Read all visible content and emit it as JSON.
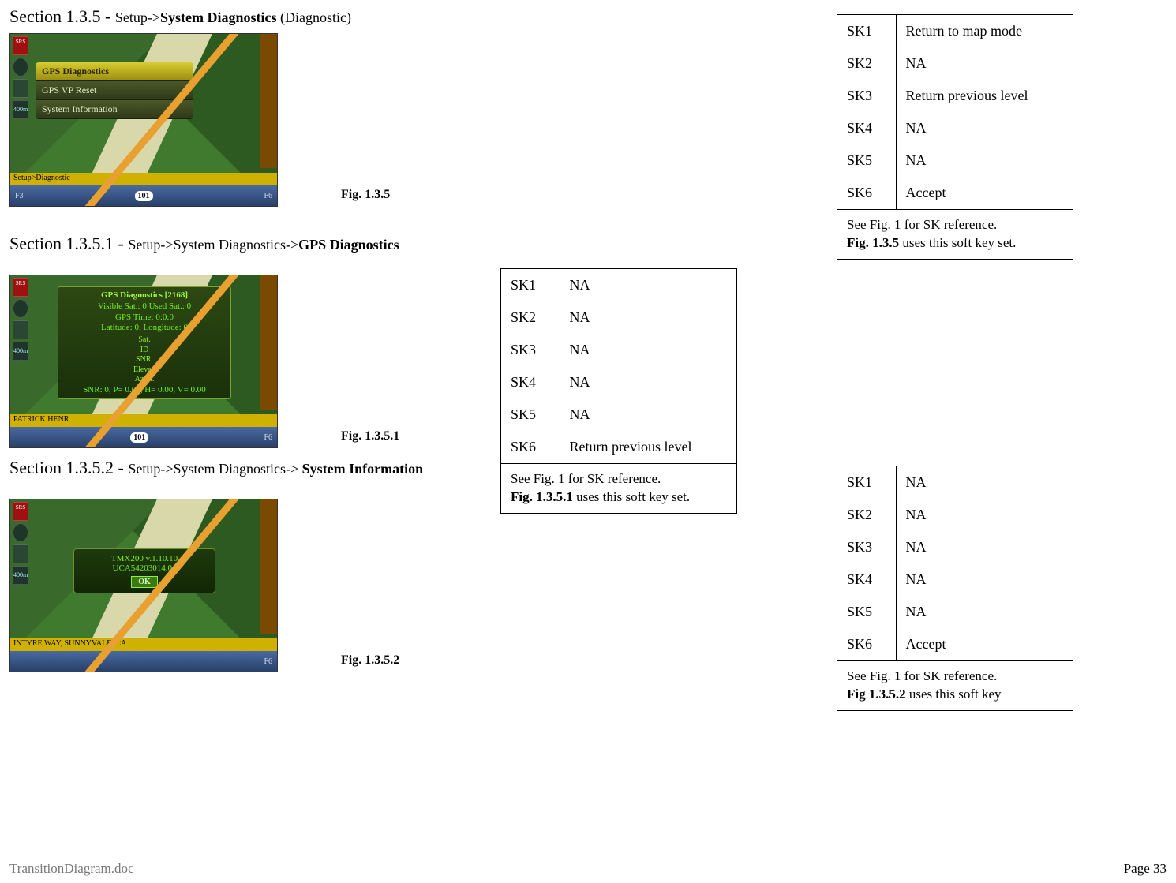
{
  "sections": {
    "s135": {
      "num": "Section 1.3.5",
      "sep": " - ",
      "path_pre": "Setup->",
      "path_bold": "System Diagnostics",
      "path_post": " (Diagnostic)"
    },
    "s1351": {
      "num": "Section 1.3.5.1",
      "sep": " - ",
      "path_pre": "Setup->System Diagnostics->",
      "path_bold": "GPS Diagnostics",
      "path_post": ""
    },
    "s1352": {
      "num": "Section 1.3.5.2",
      "sep": " - ",
      "path_pre": "Setup->System Diagnostics-> ",
      "path_bold": "System Information",
      "path_post": ""
    }
  },
  "figures": {
    "f135": "Fig. 1.3.5",
    "f1351": "Fig. 1.3.5.1",
    "f1352": "Fig. 1.3.5.2"
  },
  "screens": {
    "s135": {
      "status": "Setup>Diagnostic",
      "scale": "400m",
      "menu": [
        "GPS Diagnostics",
        "GPS VP Reset",
        "System Information"
      ],
      "bottom": {
        "f3": "F3",
        "shield": "101",
        "f6": "F6"
      }
    },
    "s1351": {
      "status": "PATRICK HENR",
      "scale": "400m",
      "diag_header": "GPS Diagnostics [2168]",
      "diag_lines": [
        "Visible Sat.: 0 Used Sat.: 0",
        "GPS Time: 0:0:0",
        "Latitude: 0, Longitude: 0"
      ],
      "diag_cols": [
        "Sat.",
        "ID",
        "SNR.",
        "Elevat.",
        "Azim."
      ],
      "diag_footer": "SNR: 0, P= 0.00, H= 0.00, V= 0.00",
      "bottom": {
        "f3": "",
        "shield": "101",
        "f6": "F6"
      }
    },
    "s1352": {
      "status": "INTYRE WAY, SUNNYVALE, CA",
      "scale": "400m",
      "info_lines": [
        "TMX200 v.1.10.10",
        "UCA54203014.01"
      ],
      "ok": "OK",
      "bottom": {
        "f3": "",
        "shield": "",
        "f6": "F6"
      }
    }
  },
  "sk_tables": {
    "t135": {
      "rows": [
        [
          "SK1",
          "Return to map mode"
        ],
        [
          "SK2",
          "NA"
        ],
        [
          "SK3",
          "Return previous level"
        ],
        [
          "SK4",
          "NA"
        ],
        [
          "SK5",
          "NA"
        ],
        [
          "SK6",
          "Accept"
        ]
      ],
      "ref_pre": "See Fig. 1 for SK reference.",
      "ref_bold": "Fig. 1.3.5",
      "ref_post": " uses this soft key set."
    },
    "t1351": {
      "rows": [
        [
          "SK1",
          "NA"
        ],
        [
          "SK2",
          "NA"
        ],
        [
          "SK3",
          "NA"
        ],
        [
          "SK4",
          "NA"
        ],
        [
          "SK5",
          "NA"
        ],
        [
          "SK6",
          "Return previous level"
        ]
      ],
      "ref_pre": "See Fig. 1 for SK reference.",
      "ref_bold": "Fig. 1.3.5.1",
      "ref_post": " uses this soft key set."
    },
    "t1352": {
      "rows": [
        [
          "SK1",
          "NA"
        ],
        [
          "SK2",
          "NA"
        ],
        [
          "SK3",
          "NA"
        ],
        [
          "SK4",
          "NA"
        ],
        [
          "SK5",
          "NA"
        ],
        [
          "SK6",
          "Accept"
        ]
      ],
      "ref_pre": "See Fig. 1 for SK reference.",
      "ref_bold": "Fig 1.3.5.2",
      "ref_post": " uses this soft key"
    }
  },
  "footer": {
    "left": "TransitionDiagram.doc",
    "right": "Page 33"
  }
}
